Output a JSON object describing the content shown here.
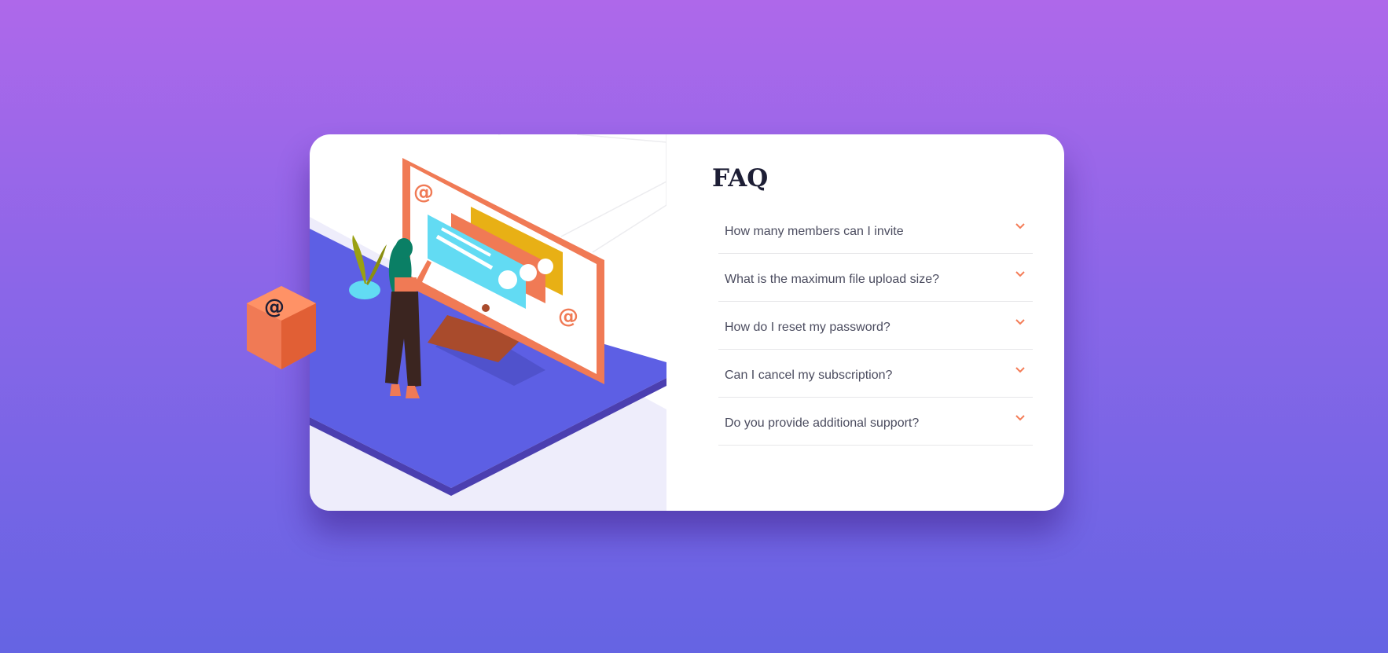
{
  "faq": {
    "title": "FAQ",
    "items": [
      {
        "question": "How many members can I invite"
      },
      {
        "question": "What is the maximum file upload size?"
      },
      {
        "question": "How do I reset my password?"
      },
      {
        "question": "Can I cancel my subscription?"
      },
      {
        "question": "Do you provide additional support?"
      }
    ]
  },
  "icons": {
    "arrow": "chevron-down-icon",
    "cube": "at-sign-box-icon"
  },
  "colors": {
    "accent": "#f47c57",
    "title": "#1d1e35",
    "question": "#4b4c5f",
    "divider": "#e7e7e9",
    "platform": "#5d5fe4"
  }
}
